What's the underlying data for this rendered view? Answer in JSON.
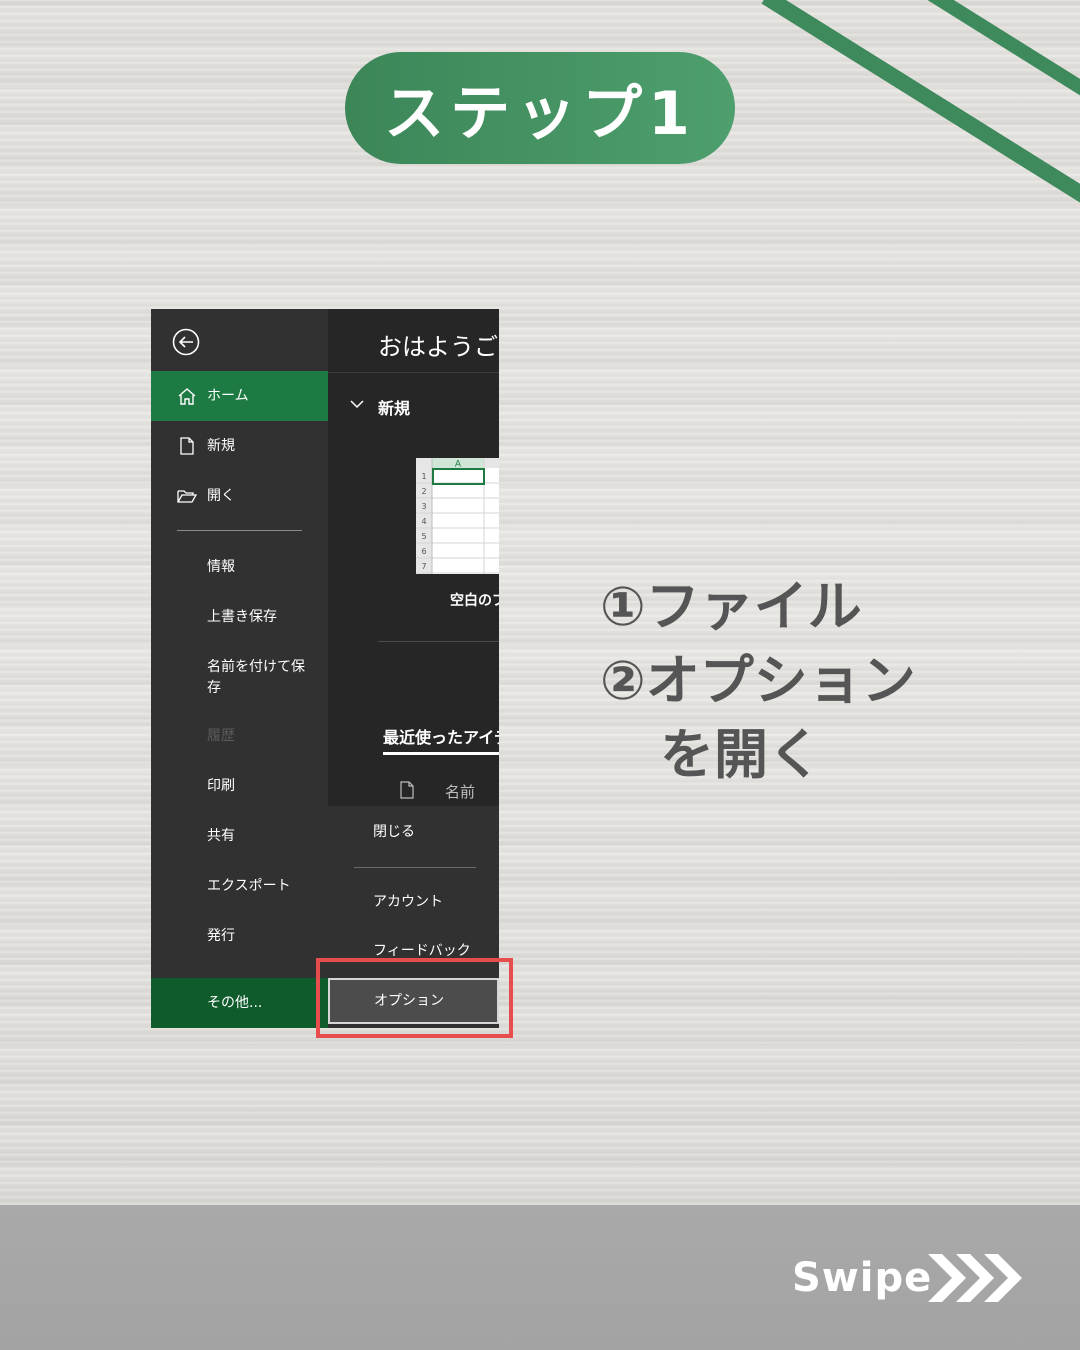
{
  "step_title": "ステップ1",
  "excel": {
    "sidebar": {
      "home": "ホーム",
      "new": "新規",
      "open": "開く",
      "info": "情報",
      "save": "上書き保存",
      "save_as_line1": "名前を付けて保",
      "save_as_line2": "存",
      "history": "履歴",
      "print": "印刷",
      "share": "共有",
      "export": "エクスポート",
      "publish": "発行",
      "more": "その他..."
    },
    "content": {
      "greeting": "おはようござ",
      "new_section": "新規",
      "blank_workbook": "空白のブ",
      "recent_tab": "最近使ったアイテ",
      "name_column": "名前",
      "thumb_col": "A",
      "thumb_rows": [
        "1",
        "2",
        "3",
        "4",
        "5",
        "6",
        "7"
      ]
    },
    "lower": {
      "close": "閉じる",
      "account": "アカウント",
      "feedback": "フィードバック",
      "options": "オプション"
    }
  },
  "instructions": {
    "line1": "①ファイル",
    "line2": "②オプション",
    "line3": "を開く"
  },
  "swipe_label": "Swipe",
  "colors": {
    "accent_green": "#3f8a5c",
    "excel_green": "#1e7a43",
    "highlight_red": "#e84d4d"
  }
}
